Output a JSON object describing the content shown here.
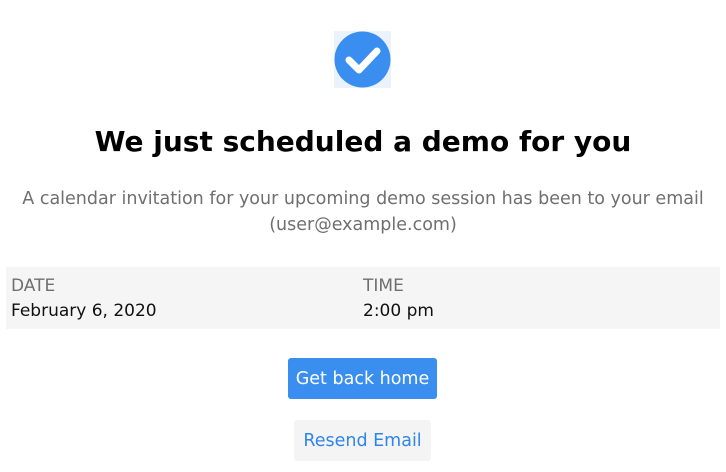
{
  "confirmation": {
    "icon": "check-circle-icon",
    "accent_color": "#3a8ef0",
    "title": "We just scheduled a demo for you",
    "message": "A calendar invitation for your upcoming demo session has been to your email (user@example.com)"
  },
  "schedule": {
    "date_label": "DATE",
    "date_value": "February 6, 2020",
    "time_label": "TIME",
    "time_value": "2:00 pm"
  },
  "actions": {
    "home_label": "Get back home",
    "resend_label": "Resend Email"
  }
}
